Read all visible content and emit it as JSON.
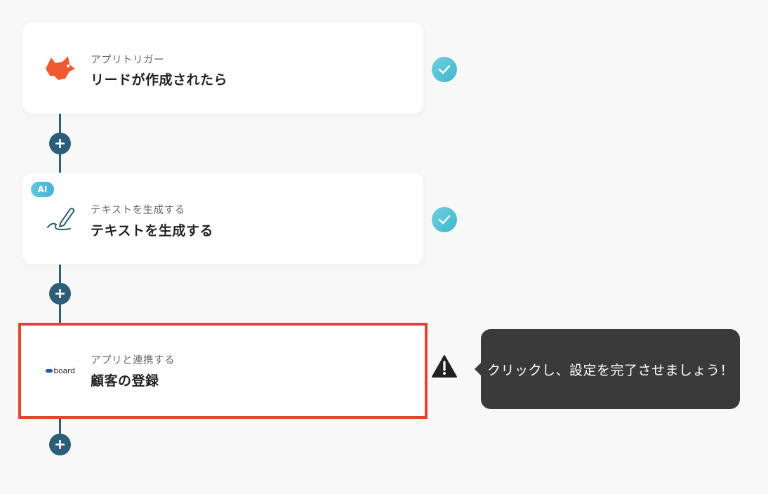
{
  "steps": [
    {
      "sub": "アプリトリガー",
      "title": "リードが作成されたら",
      "icon": "fox-app-icon",
      "status": "complete"
    },
    {
      "badge": "AI",
      "sub": "テキストを生成する",
      "title": "テキストを生成する",
      "icon": "pen-icon",
      "status": "complete"
    },
    {
      "sub": "アプリと連携する",
      "title": "顧客の登録",
      "icon": "board-logo",
      "logo_text": "board",
      "status": "warning"
    }
  ],
  "tooltip": {
    "text": "クリックし、設定を完了させましょう！"
  },
  "colors": {
    "connector": "#2e5f78",
    "check": "#45b8d0",
    "highlight": "#e5452e",
    "tooltip_bg": "#3a3a3a"
  }
}
